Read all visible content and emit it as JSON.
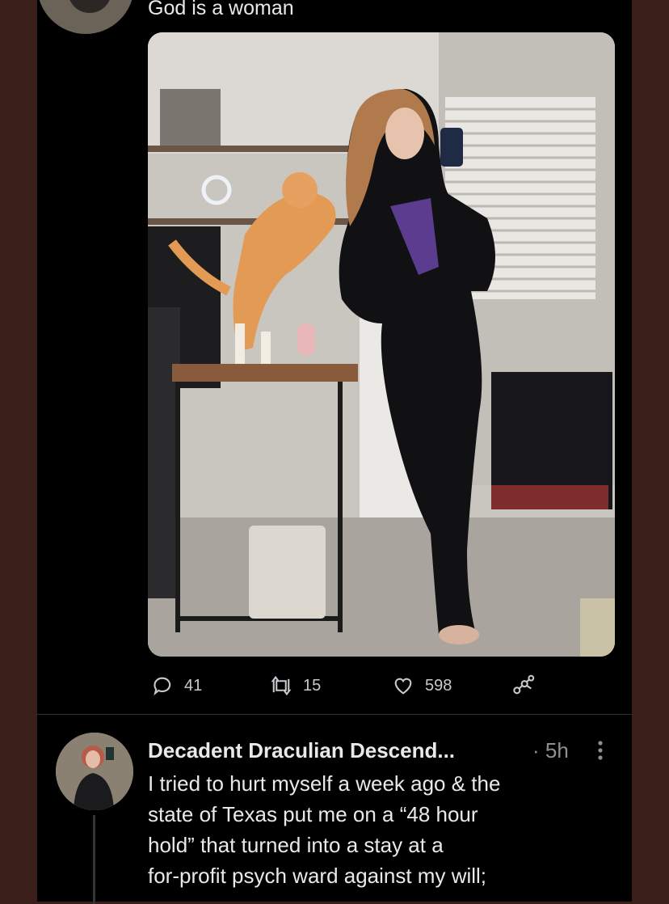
{
  "tweet1": {
    "text": "God is a woman",
    "media_description": "",
    "actions": {
      "replies": "41",
      "retweets": "15",
      "likes": "598"
    }
  },
  "tweet2": {
    "display_name": "Decadent Draculian Descend...",
    "time": "· 5h",
    "lines": [
      "I tried to hurt myself a week ago & the",
      "state of Texas put me on a “48 hour",
      "hold” that turned into a stay at a",
      "for-profit psych ward against my will;"
    ]
  },
  "colors": {
    "background": "#000000",
    "text": "#e7e9ea",
    "secondary": "#8b9095",
    "divider": "#2f3336",
    "frame": "#3b1f1b"
  }
}
